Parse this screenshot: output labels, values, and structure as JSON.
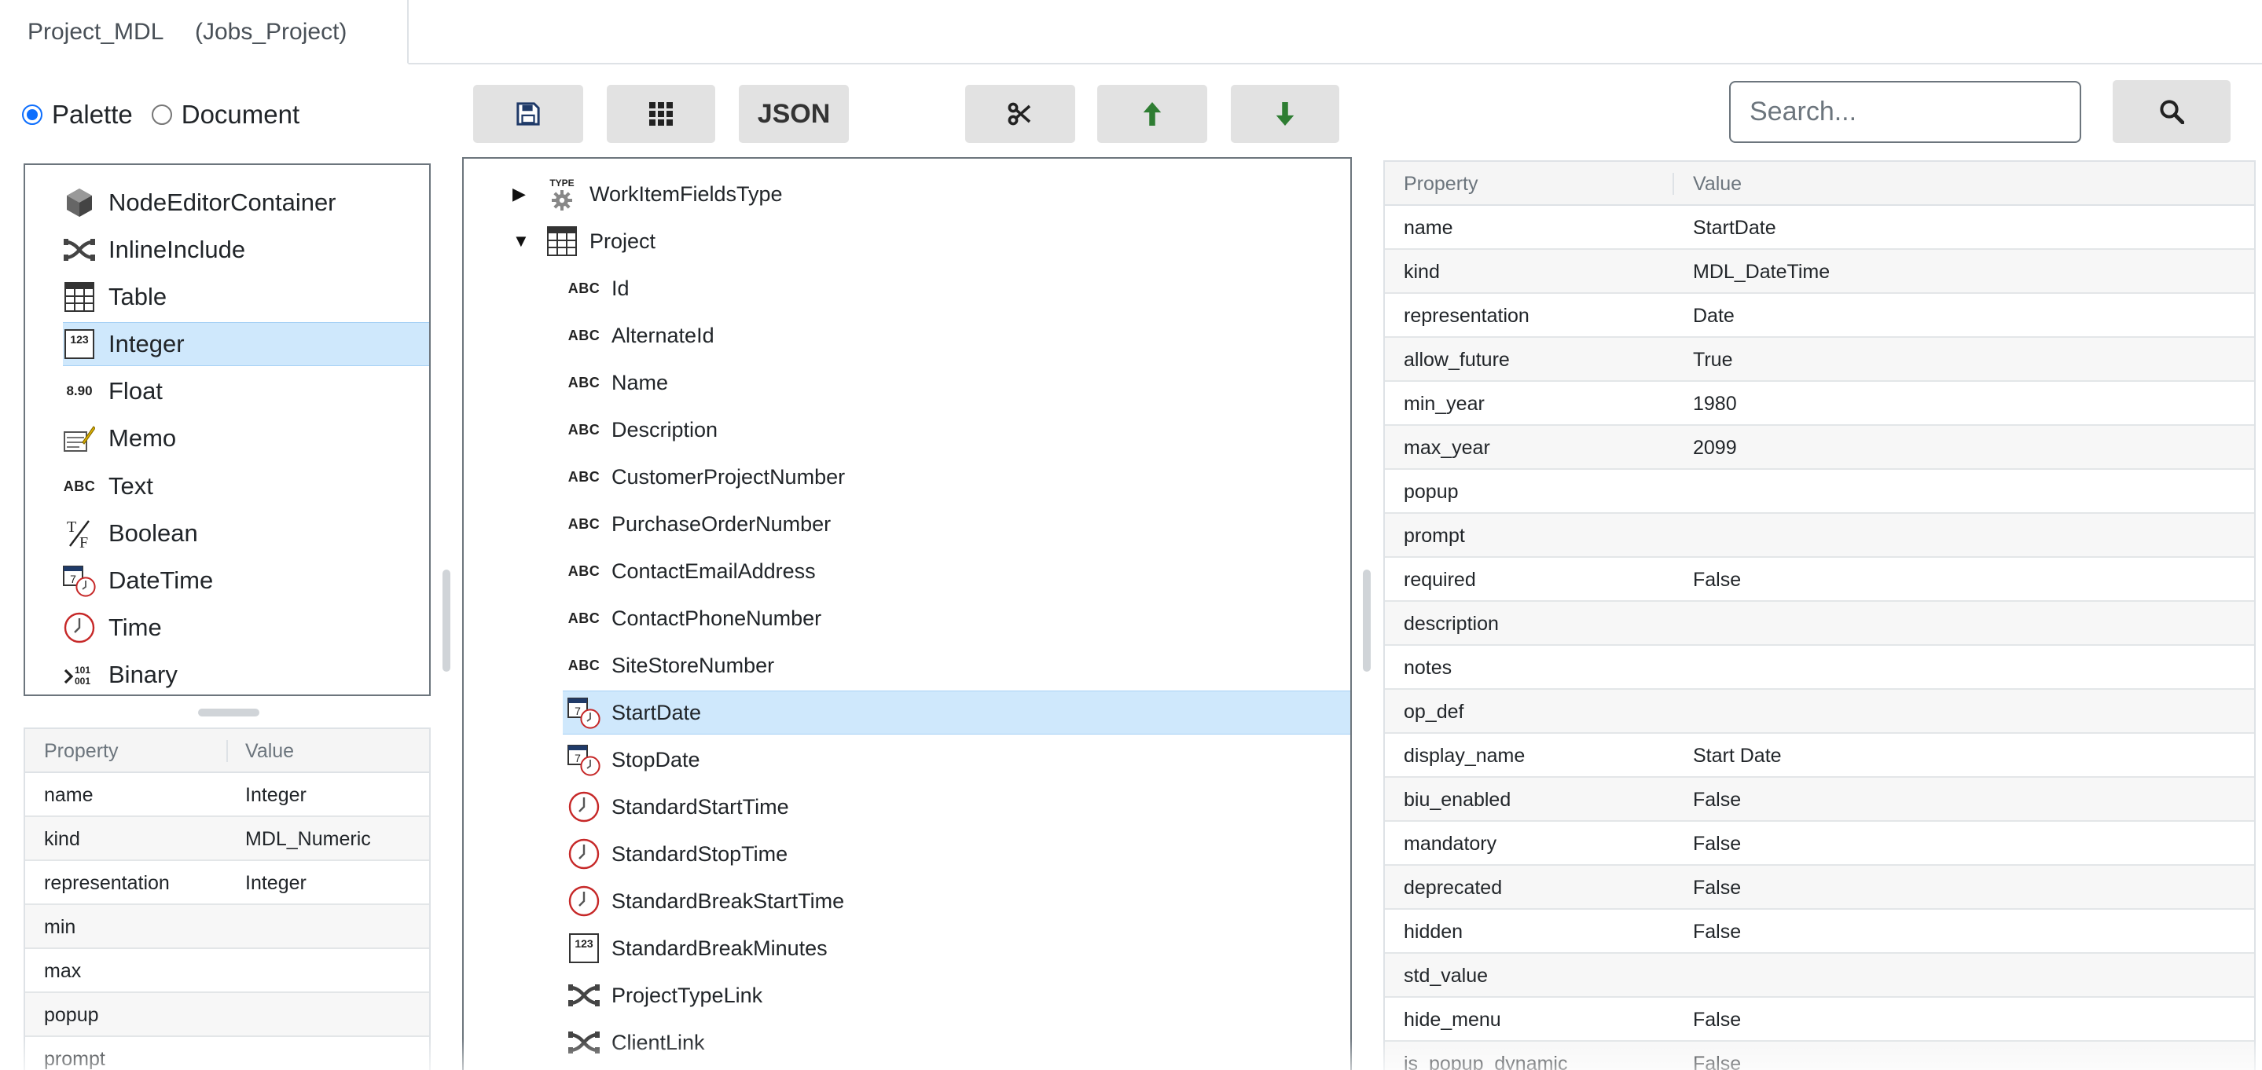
{
  "tab": {
    "name": "Project_MDL",
    "project": "(Jobs_Project)"
  },
  "mode": {
    "palette": "Palette",
    "document": "Document",
    "selected": "palette"
  },
  "toolbar": {
    "save_icon": "save-icon",
    "grid_icon": "grid-icon",
    "json_label": "JSON",
    "cut_icon": "scissors-icon",
    "up_icon": "arrow-up-icon",
    "down_icon": "arrow-down-icon",
    "arrow_color": "#2e7d32"
  },
  "search": {
    "placeholder": "Search...",
    "value": ""
  },
  "palette": {
    "items": [
      {
        "label": "NodeEditorContainer",
        "icon": "cube-icon"
      },
      {
        "label": "InlineInclude",
        "icon": "link-icon"
      },
      {
        "label": "Table",
        "icon": "table-icon"
      },
      {
        "label": "Integer",
        "icon": "integer-icon"
      },
      {
        "label": "Float",
        "icon": "float-icon",
        "icon_text": "8.90"
      },
      {
        "label": "Memo",
        "icon": "memo-icon"
      },
      {
        "label": "Text",
        "icon": "text-icon",
        "icon_text": "ABC"
      },
      {
        "label": "Boolean",
        "icon": "boolean-icon"
      },
      {
        "label": "DateTime",
        "icon": "datetime-icon"
      },
      {
        "label": "Time",
        "icon": "clock-icon"
      },
      {
        "label": "Binary",
        "icon": "binary-icon"
      }
    ],
    "selected": "Integer"
  },
  "left_props": {
    "col_property": "Property",
    "col_value": "Value",
    "rows": [
      {
        "name": "name",
        "value": "Integer"
      },
      {
        "name": "kind",
        "value": "MDL_Numeric"
      },
      {
        "name": "representation",
        "value": "Integer"
      },
      {
        "name": "min",
        "value": ""
      },
      {
        "name": "max",
        "value": ""
      },
      {
        "name": "popup",
        "value": ""
      },
      {
        "name": "prompt",
        "value": ""
      }
    ]
  },
  "tree": {
    "nodes": [
      {
        "label": "WorkItemFieldsType",
        "icon": "type-icon",
        "icon_text": "TYPE",
        "level": 0,
        "arrow": "▶"
      },
      {
        "label": "Project",
        "icon": "table-icon",
        "level": 0,
        "arrow": "▼"
      },
      {
        "label": "Id",
        "icon": "text-icon",
        "icon_text": "ABC",
        "level": 1
      },
      {
        "label": "AlternateId",
        "icon": "text-icon",
        "icon_text": "ABC",
        "level": 1
      },
      {
        "label": "Name",
        "icon": "text-icon",
        "icon_text": "ABC",
        "level": 1
      },
      {
        "label": "Description",
        "icon": "text-icon",
        "icon_text": "ABC",
        "level": 1
      },
      {
        "label": "CustomerProjectNumber",
        "icon": "text-icon",
        "icon_text": "ABC",
        "level": 1
      },
      {
        "label": "PurchaseOrderNumber",
        "icon": "text-icon",
        "icon_text": "ABC",
        "level": 1
      },
      {
        "label": "ContactEmailAddress",
        "icon": "text-icon",
        "icon_text": "ABC",
        "level": 1
      },
      {
        "label": "ContactPhoneNumber",
        "icon": "text-icon",
        "icon_text": "ABC",
        "level": 1
      },
      {
        "label": "SiteStoreNumber",
        "icon": "text-icon",
        "icon_text": "ABC",
        "level": 1
      },
      {
        "label": "StartDate",
        "icon": "datetime-icon",
        "level": 1
      },
      {
        "label": "StopDate",
        "icon": "datetime-icon",
        "level": 1
      },
      {
        "label": "StandardStartTime",
        "icon": "clock-icon",
        "level": 1
      },
      {
        "label": "StandardStopTime",
        "icon": "clock-icon",
        "level": 1
      },
      {
        "label": "StandardBreakStartTime",
        "icon": "clock-icon",
        "level": 1
      },
      {
        "label": "StandardBreakMinutes",
        "icon": "integer-icon",
        "level": 1
      },
      {
        "label": "ProjectTypeLink",
        "icon": "link-icon",
        "level": 1
      },
      {
        "label": "ClientLink",
        "icon": "link-icon",
        "level": 1
      }
    ],
    "selected": "StartDate"
  },
  "right_props": {
    "col_property": "Property",
    "col_value": "Value",
    "rows": [
      {
        "name": "name",
        "value": "StartDate"
      },
      {
        "name": "kind",
        "value": "MDL_DateTime"
      },
      {
        "name": "representation",
        "value": "Date"
      },
      {
        "name": "allow_future",
        "value": "True"
      },
      {
        "name": "min_year",
        "value": "1980"
      },
      {
        "name": "max_year",
        "value": "2099"
      },
      {
        "name": "popup",
        "value": ""
      },
      {
        "name": "prompt",
        "value": ""
      },
      {
        "name": "required",
        "value": "False"
      },
      {
        "name": "description",
        "value": ""
      },
      {
        "name": "notes",
        "value": ""
      },
      {
        "name": "op_def",
        "value": ""
      },
      {
        "name": "display_name",
        "value": "Start Date"
      },
      {
        "name": "biu_enabled",
        "value": "False"
      },
      {
        "name": "mandatory",
        "value": "False"
      },
      {
        "name": "deprecated",
        "value": "False"
      },
      {
        "name": "hidden",
        "value": "False"
      },
      {
        "name": "std_value",
        "value": ""
      },
      {
        "name": "hide_menu",
        "value": "False"
      },
      {
        "name": "is_popup_dynamic",
        "value": "False"
      }
    ]
  },
  "colors": {
    "selection": "#cfe8fc",
    "radio_accent": "#0d6efd",
    "button_bg": "#e2e2e2"
  }
}
